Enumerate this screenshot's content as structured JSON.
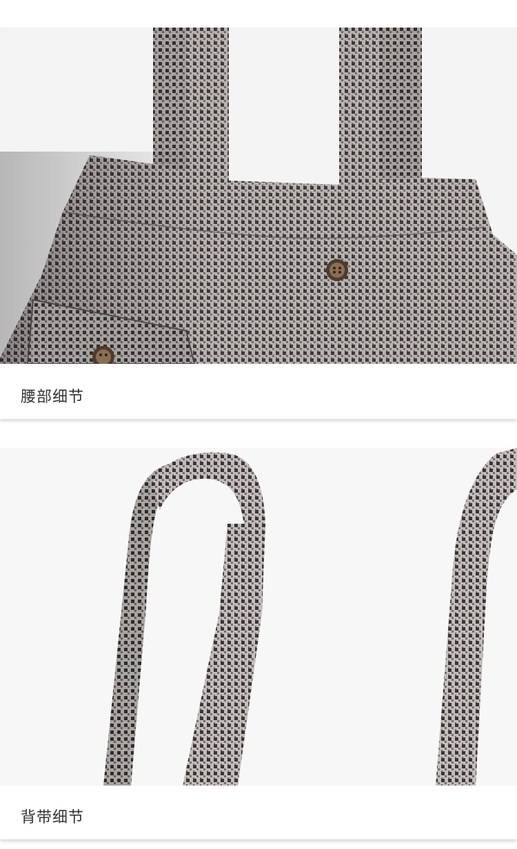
{
  "sections": [
    {
      "caption": "腰部细节",
      "photo_icon": "waist-detail-photo"
    },
    {
      "caption": "背带细节",
      "photo_icon": "strap-detail-photo"
    }
  ],
  "colors": {
    "fabric_light": "#b7b3b1",
    "fabric_dark": "#3d3938",
    "fabric_accent": "#6b3a45",
    "background": "#f7f7f7",
    "caption_text": "#333333",
    "button": "#5b4634"
  }
}
